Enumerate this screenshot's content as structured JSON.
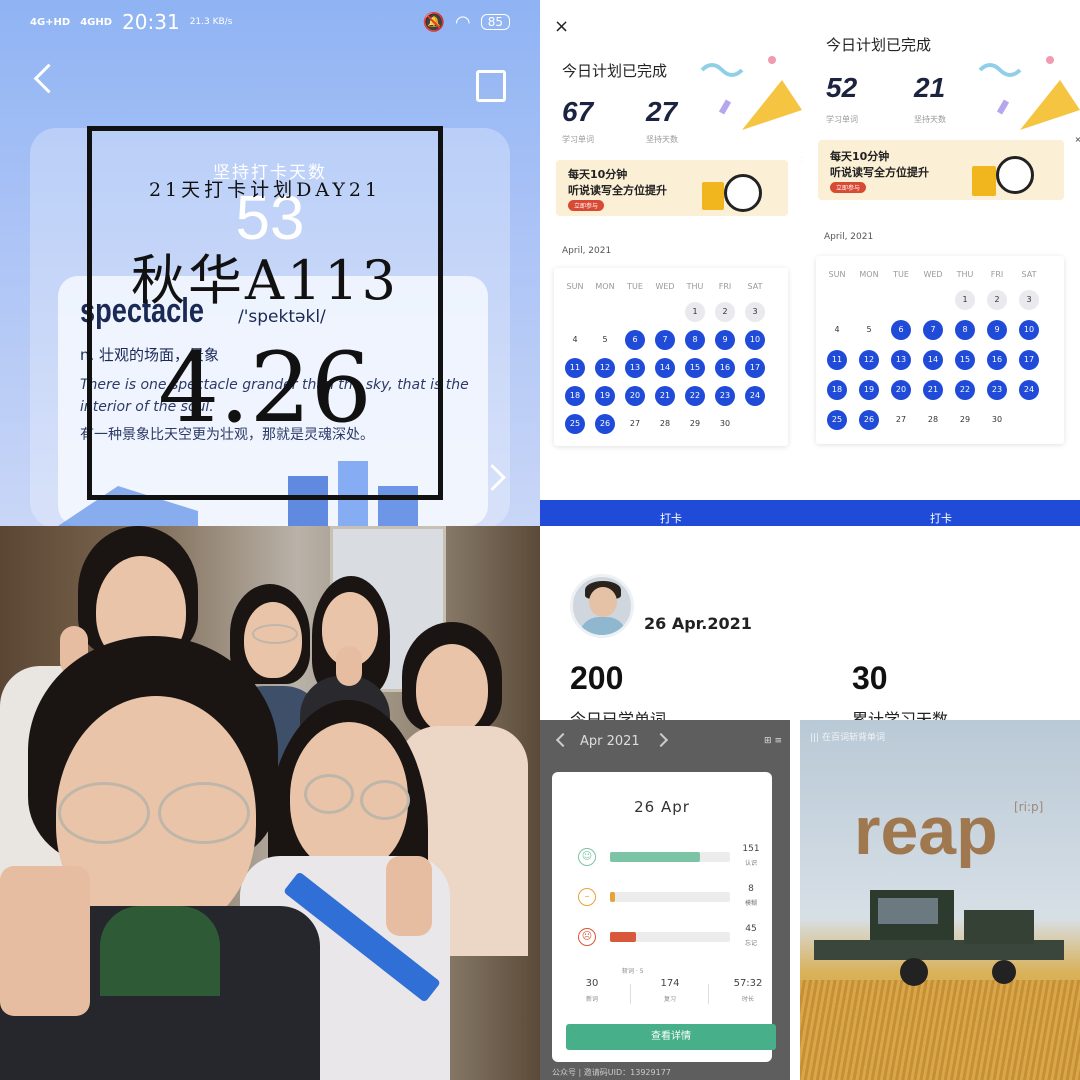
{
  "panel_vocab": {
    "status": {
      "signal1": "4G+HD",
      "signal2": "4GHD",
      "time": "20:31",
      "speed": "21.3 KB/s",
      "battery": "85"
    },
    "streak_title": "坚持打卡天数",
    "streak_days": "53",
    "word": "spectacle",
    "phonetic": "/'spektəkl/",
    "meaning": "n. 壮观的场面，景象",
    "example_en": "There is one spectacle grander than the sky, that is the interior of the soul.",
    "example_cn": "有一种景象比天空更为壮观，那就是灵魂深处。",
    "overlay": {
      "line1": "21天打卡计划DAY21",
      "line2": "秋华A113",
      "line3": "4.26"
    }
  },
  "calendar_a": {
    "close": "×",
    "title": "今日计划已完成",
    "words_num": "67",
    "words_label": "学习单词",
    "days_num": "27",
    "days_label": "坚持天数",
    "banner_l1": "每天10分钟",
    "banner_l2": "听说读写全方位提升",
    "banner_btn": "立即参与",
    "month": "April, 2021",
    "weekdays": [
      "SUN",
      "MON",
      "TUE",
      "WED",
      "THU",
      "FRI",
      "SAT"
    ],
    "checkin": "打卡"
  },
  "calendar_b": {
    "title": "今日计划已完成",
    "words_num": "52",
    "words_label": "学习单词",
    "days_num": "21",
    "days_label": "坚持天数",
    "banner_l1": "每天10分钟",
    "banner_l2": "听说读写全方位提升",
    "banner_btn": "立即参与",
    "month": "April, 2021",
    "weekdays": [
      "SUN",
      "MON",
      "TUE",
      "WED",
      "THU",
      "FRI",
      "SAT"
    ],
    "checkin": "打卡"
  },
  "calendar_days": [
    "1",
    "2",
    "3",
    "4",
    "5",
    "6",
    "7",
    "8",
    "9",
    "10",
    "11",
    "12",
    "13",
    "14",
    "15",
    "16",
    "17",
    "18",
    "19",
    "20",
    "21",
    "22",
    "23",
    "24",
    "25",
    "26",
    "27",
    "28",
    "29",
    "30"
  ],
  "profile": {
    "date": "26 Apr.2021",
    "learned_num": "200",
    "learned_label": "今日已学单词",
    "total_num": "30",
    "total_label": "累计学习天数"
  },
  "stats": {
    "month": "Apr 2021",
    "tools": "⊞ ≡",
    "day": "26 Apr",
    "rows": [
      {
        "face": "☺",
        "count": "151",
        "label": "认识",
        "color": "#7dc4a6",
        "fill": 0.75
      },
      {
        "face": "😐",
        "count": "8",
        "label": "模糊",
        "color": "#e8a23a",
        "fill": 0.04
      },
      {
        "face": "☹",
        "count": "45",
        "label": "忘记",
        "color": "#d9573a",
        "fill": 0.22
      }
    ],
    "note": "斩词 · 5",
    "summary": [
      {
        "value": "30",
        "label": "新词"
      },
      {
        "value": "174",
        "label": "复习"
      },
      {
        "value": "57:32",
        "label": "时长"
      }
    ],
    "button": "查看详情",
    "footer": "公众号 | 邀请码UID：13929177"
  },
  "reap": {
    "tag": "||| 在百词斩背单词",
    "word": "reap",
    "phonetic": "[ri:p]"
  }
}
